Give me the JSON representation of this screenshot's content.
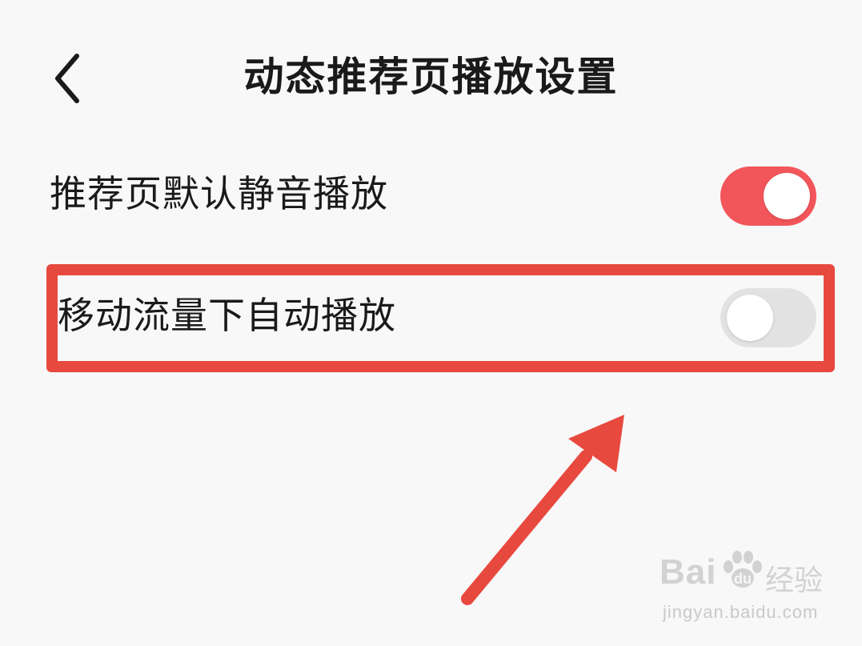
{
  "header": {
    "title": "动态推荐页播放设置",
    "back_icon": "chevron-left-icon"
  },
  "settings": [
    {
      "label": "推荐页默认静音播放",
      "enabled": true
    },
    {
      "label": "移动流量下自动播放",
      "enabled": false
    }
  ],
  "colors": {
    "toggle_on": "#f2555a",
    "toggle_off": "#e2e2e2",
    "highlight": "#e8493f"
  },
  "watermark": {
    "brand_left": "Bai",
    "brand_right": "du",
    "brand_cn": "经验",
    "url": "jingyan.baidu.com"
  }
}
